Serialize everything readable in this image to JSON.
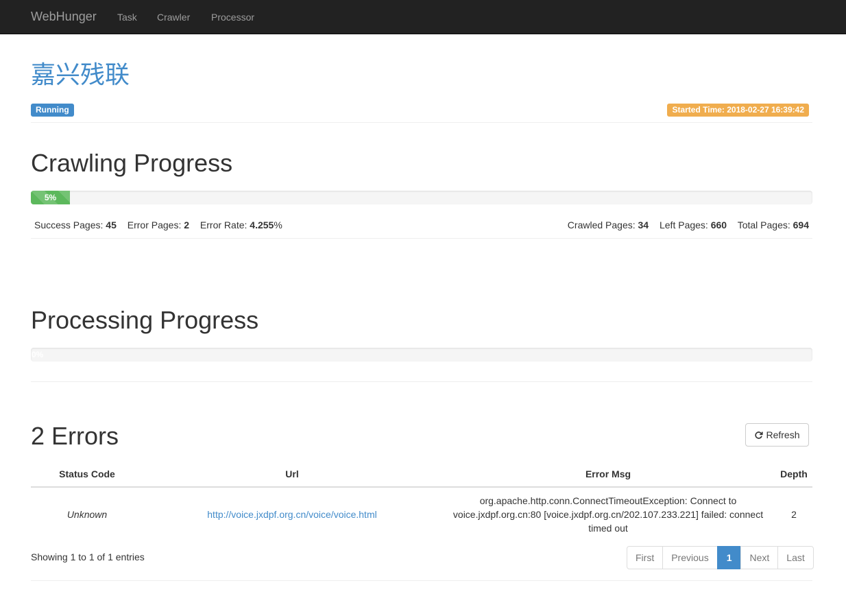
{
  "navbar": {
    "brand": "WebHunger",
    "links": [
      "Task",
      "Crawler",
      "Processor"
    ]
  },
  "task": {
    "title": "嘉兴残联",
    "status": "Running",
    "started_time": "Started Time: 2018-02-27 16:39:42"
  },
  "crawling": {
    "heading": "Crawling Progress",
    "progress_label": "5%",
    "progress_fraction": 0.05,
    "success_label": "Success Pages: ",
    "success_value": "45",
    "error_label": "Error Pages: ",
    "error_value": "2",
    "error_rate_label": "Error Rate: ",
    "error_rate_value": "4.255",
    "error_rate_unit": "%",
    "crawled_label": "Crawled Pages: ",
    "crawled_value": "34",
    "left_label": "Left Pages: ",
    "left_value": "660",
    "total_label": "Total Pages: ",
    "total_value": "694"
  },
  "processing": {
    "heading": "Processing Progress",
    "progress_label": "0%",
    "progress_fraction": 0
  },
  "errors": {
    "heading": "2 Errors",
    "refresh_label": "Refresh",
    "columns": [
      "Status Code",
      "Url",
      "Error Msg",
      "Depth"
    ],
    "rows": [
      {
        "status": "Unknown",
        "url": "http://voice.jxdpf.org.cn/voice/voice.html",
        "msg_lines": [
          "org.apache.http.conn.ConnectTimeoutException: Connect to",
          "voice.jxdpf.org.cn:80 [voice.jxdpf.org.cn/202.107.233.221] failed: connect",
          "timed out"
        ],
        "depth": "2"
      }
    ],
    "info": "Showing 1 to 1 of 1 entries",
    "pagination": [
      "First",
      "Previous",
      "1",
      "Next",
      "Last"
    ]
  }
}
